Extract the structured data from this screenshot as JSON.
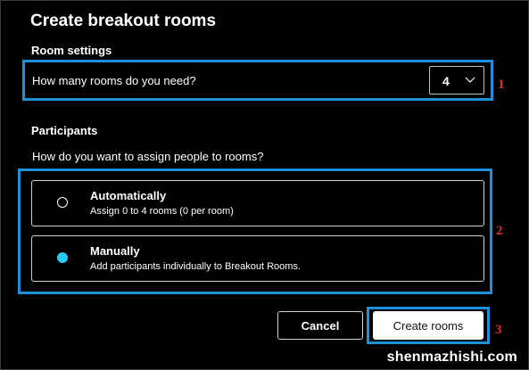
{
  "dialog": {
    "title": "Create breakout rooms"
  },
  "room_settings": {
    "heading": "Room settings",
    "question": "How many rooms do you need?",
    "selected_count": "4"
  },
  "participants": {
    "heading": "Participants",
    "question": "How do you want to assign people to rooms?",
    "options": [
      {
        "title": "Automatically",
        "description": "Assign 0 to 4 rooms (0 per room)",
        "selected": false
      },
      {
        "title": "Manually",
        "description": "Add participants individually to Breakout Rooms.",
        "selected": true
      }
    ]
  },
  "buttons": {
    "cancel": "Cancel",
    "create": "Create rooms"
  },
  "annotations": {
    "marker_1": "1",
    "marker_2": "2",
    "marker_3": "3",
    "highlight_color": "#1e8fd8",
    "marker_color": "#e02a2a"
  },
  "colors": {
    "background": "#000000",
    "radio_selected": "#29c8f5"
  },
  "watermark": "shenmazhishi.com"
}
